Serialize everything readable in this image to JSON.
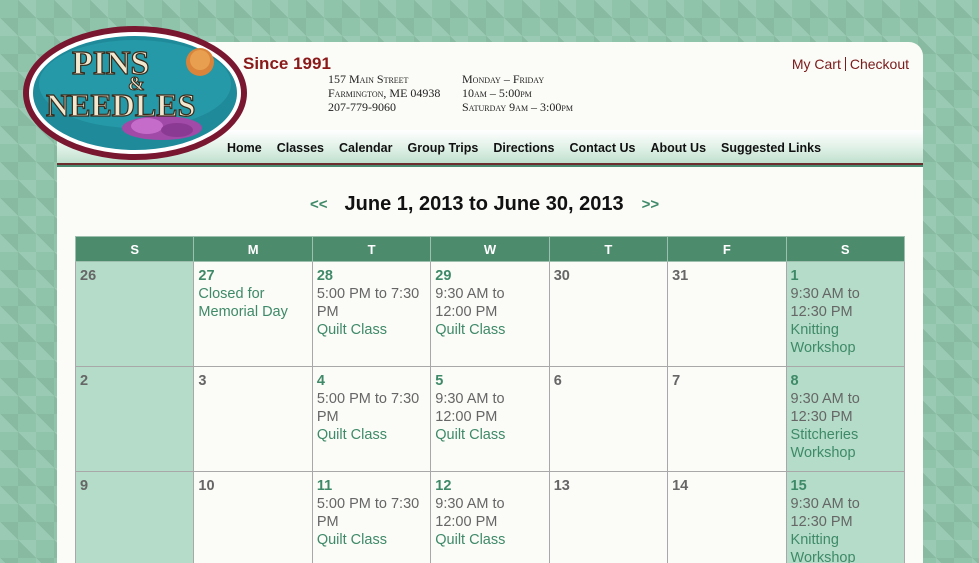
{
  "header": {
    "since": "Since 1991",
    "address": [
      "157 Main Street",
      "Farmington, ME 04938",
      "207-779-9060"
    ],
    "hours": [
      "Monday – Friday",
      "10am – 5:00pm",
      "Saturday 9am – 3:00pm"
    ],
    "cart_label": "My Cart",
    "checkout_label": "Checkout",
    "logo_text_top": "PINS",
    "logo_text_amp": "&",
    "logo_text_bottom": "NEEDLES"
  },
  "nav": [
    "Home",
    "Classes",
    "Calendar",
    "Group Trips",
    "Directions",
    "Contact Us",
    "About Us",
    "Suggested Links"
  ],
  "calendar": {
    "prev_label": "<<",
    "next_label": ">>",
    "title": "June 1, 2013 to June 30, 2013",
    "weekdays": [
      "S",
      "M",
      "T",
      "W",
      "T",
      "F",
      "S"
    ],
    "weeks": [
      [
        {
          "day": "26",
          "active": false,
          "events": []
        },
        {
          "day": "27",
          "active": true,
          "events": [
            {
              "time": "",
              "title": "Closed for Memorial Day"
            }
          ]
        },
        {
          "day": "28",
          "active": true,
          "events": [
            {
              "time": "5:00 PM to 7:30 PM",
              "title": "Quilt Class"
            }
          ]
        },
        {
          "day": "29",
          "active": true,
          "events": [
            {
              "time": "9:30 AM to 12:00 PM",
              "title": "Quilt Class"
            }
          ]
        },
        {
          "day": "30",
          "active": false,
          "events": []
        },
        {
          "day": "31",
          "active": false,
          "events": []
        },
        {
          "day": "1",
          "active": true,
          "events": [
            {
              "time": "9:30 AM to 12:30 PM",
              "title": "Knitting Workshop"
            }
          ]
        }
      ],
      [
        {
          "day": "2",
          "active": false,
          "events": []
        },
        {
          "day": "3",
          "active": false,
          "events": []
        },
        {
          "day": "4",
          "active": true,
          "events": [
            {
              "time": "5:00 PM to 7:30 PM",
              "title": "Quilt Class"
            }
          ]
        },
        {
          "day": "5",
          "active": true,
          "events": [
            {
              "time": "9:30 AM to 12:00 PM",
              "title": "Quilt Class"
            }
          ]
        },
        {
          "day": "6",
          "active": false,
          "events": []
        },
        {
          "day": "7",
          "active": false,
          "events": []
        },
        {
          "day": "8",
          "active": true,
          "events": [
            {
              "time": "9:30 AM to 12:30 PM",
              "title": "Stitcheries Workshop"
            }
          ]
        }
      ],
      [
        {
          "day": "9",
          "active": false,
          "events": []
        },
        {
          "day": "10",
          "active": false,
          "events": []
        },
        {
          "day": "11",
          "active": true,
          "events": [
            {
              "time": "5:00 PM to 7:30 PM",
              "title": "Quilt Class"
            }
          ]
        },
        {
          "day": "12",
          "active": true,
          "events": [
            {
              "time": "9:30 AM to 12:00 PM",
              "title": "Quilt Class"
            }
          ]
        },
        {
          "day": "13",
          "active": false,
          "events": []
        },
        {
          "day": "14",
          "active": false,
          "events": []
        },
        {
          "day": "15",
          "active": true,
          "events": [
            {
              "time": "9:30 AM to 12:30 PM",
              "title": "Knitting Workshop"
            }
          ]
        }
      ]
    ]
  },
  "colors": {
    "accent_green": "#3e8a68",
    "header_green": "#4d8b6d",
    "weekend_bg": "#b4dcc8",
    "brand_red": "#8a1a1a"
  }
}
